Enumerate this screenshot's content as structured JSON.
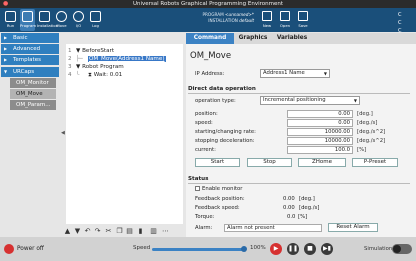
{
  "window": {
    "title": "Universal Robots Graphical Programming Environment"
  },
  "toolbar": {
    "items": [
      {
        "label": "Run"
      },
      {
        "label": "Program"
      },
      {
        "label": "Installation"
      },
      {
        "label": "Move"
      },
      {
        "label": "I/O"
      },
      {
        "label": "Log"
      }
    ],
    "program_label": "PROGRAM",
    "program_value": "<unnamed>*",
    "installation_label": "INSTALLATION",
    "installation_value": "default",
    "right": [
      {
        "label": "New"
      },
      {
        "label": "Open"
      },
      {
        "label": "Save"
      }
    ],
    "cc": "C C"
  },
  "sidebar": {
    "basic": "Basic",
    "advanced": "Advanced",
    "templates": "Templates",
    "urcaps": "URCaps",
    "urcaps_items": [
      "OM_Monitor",
      "OM_Move",
      "OM_Param..."
    ]
  },
  "tree": {
    "rows": [
      {
        "num": "1",
        "indent": 0,
        "arrow": "▼",
        "text": "BeforeStart"
      },
      {
        "num": "2",
        "indent": 1,
        "arrow": "",
        "text": "OM_Move(Address1 Name)"
      },
      {
        "num": "3",
        "indent": 0,
        "arrow": "▼",
        "text": "Robot Program"
      },
      {
        "num": "4",
        "indent": 1,
        "arrow": "⧗",
        "text": "Wait: 0.01"
      }
    ]
  },
  "tabs": [
    "Command",
    "Graphics",
    "Variables"
  ],
  "panel": {
    "title": "OM_Move",
    "ip_label": "IP Address:",
    "ip_value": "Address1 Name",
    "direct_section": "Direct data operation",
    "op_type_label": "operation type:",
    "op_type_value": "Incremental positioning",
    "fields": [
      {
        "label": "position:",
        "value": "0.00",
        "unit": "[deg.]"
      },
      {
        "label": "speed:",
        "value": "0.00",
        "unit": "[deg./s]"
      },
      {
        "label": "starting/changing rate:",
        "value": "10000.00",
        "unit": "[deg./s^2]"
      },
      {
        "label": "stopping deceleration:",
        "value": "10000.00",
        "unit": "[deg./s^2]"
      },
      {
        "label": "current:",
        "value": "100.0",
        "unit": "[%]"
      }
    ],
    "buttons": [
      "Start",
      "Stop",
      "ZHome",
      "P-Preset"
    ],
    "status_section": "Status",
    "enable_monitor": "Enable monitor",
    "feedback_position_label": "Feedback position:",
    "feedback_position_value": "0.00",
    "feedback_position_unit": "[deg.]",
    "feedback_speed_label": "Feedback speed:",
    "feedback_speed_value": "0.00",
    "feedback_speed_unit": "[deg./s]",
    "torque_label": "Torque:",
    "torque_value": "0.0",
    "torque_unit": "[%]",
    "alarm_label": "Alarm:",
    "alarm_value": "Alarm not present",
    "reset_alarm": "Reset Alarm"
  },
  "bottom": {
    "power": "Power off",
    "speed_label": "Speed",
    "speed_value": "100%",
    "simulation_label": "Simulation"
  },
  "controls": {
    "speed_fraction": 1.0
  }
}
